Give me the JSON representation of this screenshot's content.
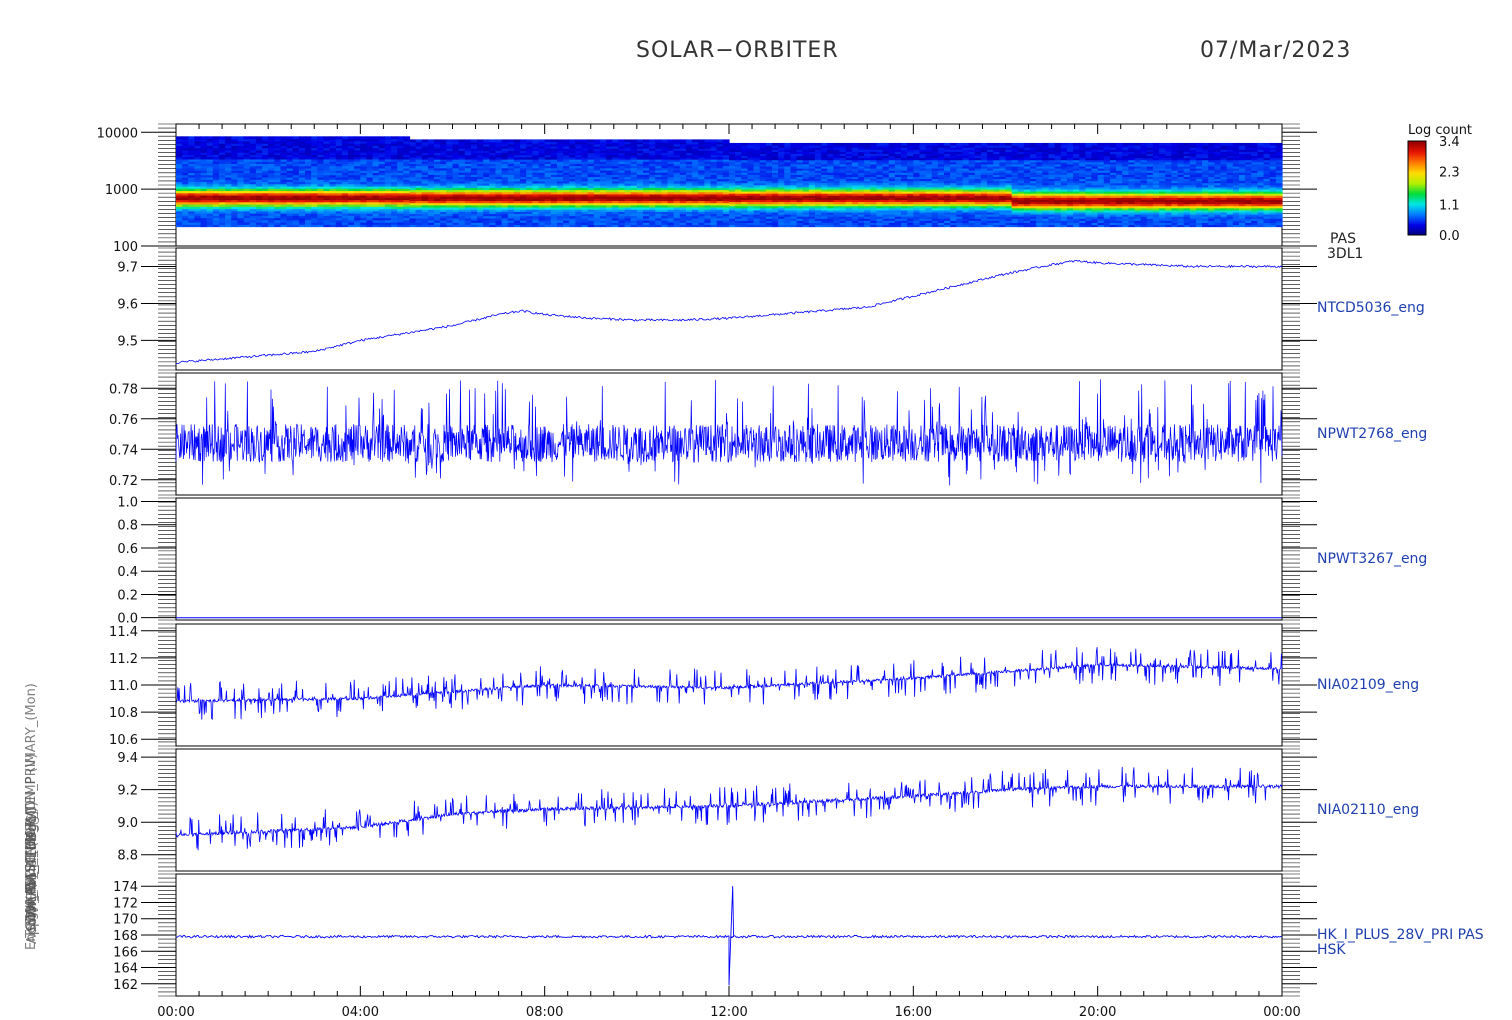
{
  "header": {
    "mission": "SOLAR−ORBITER",
    "date": "07/Mar/2023"
  },
  "left_axis_labels": [
    "Energy (eV)",
    "Approx Temp (DegC)",
    "TCDM_FS_SENSOR_TEMP (V)",
    "SWA_PAS_TEMP (V)",
    "SWA_EAS_TEMP",
    "THERM_AL (DegC)",
    "(mA) DM_HK_IMON_PRIMARY_(Mon)"
  ],
  "chart_data": [
    {
      "type": "heatmap",
      "panel": "PAS 3DL1",
      "right_label": [
        "PAS",
        "3DL1"
      ],
      "ylabel": "Energy (eV)",
      "yscale": "log",
      "yticks": [
        100,
        1000,
        10000
      ],
      "ylim": [
        100,
        14000
      ],
      "colorbar": {
        "title": "Log count",
        "ticks": [
          3.4,
          2.3,
          1.1,
          0.0
        ],
        "range": [
          0.0,
          3.4
        ],
        "colormap": "rainbow"
      },
      "bands_description": "Peak energy band near 700 eV across the day"
    },
    {
      "type": "line",
      "panel": "NTCD5036_eng",
      "right_label": "NTCD5036_eng",
      "ylim": [
        9.42,
        9.75
      ],
      "yticks": [
        9.5,
        9.6,
        9.7
      ],
      "x_hours": [
        0,
        1,
        2,
        3,
        4,
        5,
        6,
        7,
        7.5,
        8,
        9,
        10,
        11,
        12,
        13,
        14,
        15,
        16,
        17,
        18,
        19,
        19.5,
        20,
        21,
        22,
        23,
        24
      ],
      "values": [
        9.44,
        9.45,
        9.46,
        9.47,
        9.5,
        9.52,
        9.54,
        9.57,
        9.58,
        9.57,
        9.56,
        9.555,
        9.555,
        9.56,
        9.57,
        9.58,
        9.59,
        9.62,
        9.65,
        9.68,
        9.705,
        9.715,
        9.71,
        9.705,
        9.7,
        9.7,
        9.7
      ],
      "color": "#0000ff"
    },
    {
      "type": "line",
      "panel": "NPWT2768_eng",
      "right_label": "NPWT2768_eng",
      "ylim": [
        0.71,
        0.79
      ],
      "yticks": [
        0.72,
        0.74,
        0.76,
        0.78
      ],
      "noise_center": 0.744,
      "noise_range": [
        0.715,
        0.786
      ],
      "color": "#0000ff"
    },
    {
      "type": "line",
      "panel": "NPWT3267_eng",
      "right_label": "NPWT3267_eng",
      "ylim": [
        -0.02,
        1.03
      ],
      "yticks": [
        0.0,
        0.2,
        0.4,
        0.6,
        0.8,
        1.0
      ],
      "constant_value": 0.0,
      "color": "#0000ff"
    },
    {
      "type": "line",
      "panel": "NIA02109_eng",
      "right_label": "NIA02109_eng",
      "ylim": [
        10.55,
        11.45
      ],
      "yticks": [
        10.6,
        10.8,
        11.0,
        11.2,
        11.4
      ],
      "x_hours": [
        0,
        4,
        6,
        8,
        12,
        16,
        18,
        20,
        24
      ],
      "values": [
        10.88,
        10.9,
        10.95,
        11.0,
        10.98,
        11.05,
        11.1,
        11.15,
        11.12
      ],
      "color": "#0000ff"
    },
    {
      "type": "line",
      "panel": "NIA02110_eng",
      "right_label": "NIA02110_eng",
      "ylim": [
        8.7,
        9.45
      ],
      "yticks": [
        8.8,
        9.0,
        9.2,
        9.4
      ],
      "x_hours": [
        0,
        4,
        6,
        8,
        12,
        16,
        18,
        20,
        24
      ],
      "values": [
        8.92,
        8.97,
        9.05,
        9.08,
        9.1,
        9.16,
        9.2,
        9.22,
        9.22
      ],
      "color": "#0000ff"
    },
    {
      "type": "line",
      "panel": "HK_I_PLUS_28V_PRI PAS HSK",
      "right_label": [
        "HK_I_PLUS_28V_PRI PAS",
        "HSK"
      ],
      "ylim": [
        160.5,
        175.5
      ],
      "yticks": [
        162,
        164,
        166,
        168,
        170,
        172,
        174
      ],
      "baseline": 167.8,
      "spike": {
        "hour": 12.0,
        "min": 161.8,
        "max": 174.0
      },
      "color": "#0000ff"
    }
  ],
  "x_axis": {
    "range_hours": [
      0,
      24
    ],
    "tick_labels": [
      "00:00",
      "04:00",
      "08:00",
      "12:00",
      "16:00",
      "20:00",
      "00:00"
    ]
  }
}
